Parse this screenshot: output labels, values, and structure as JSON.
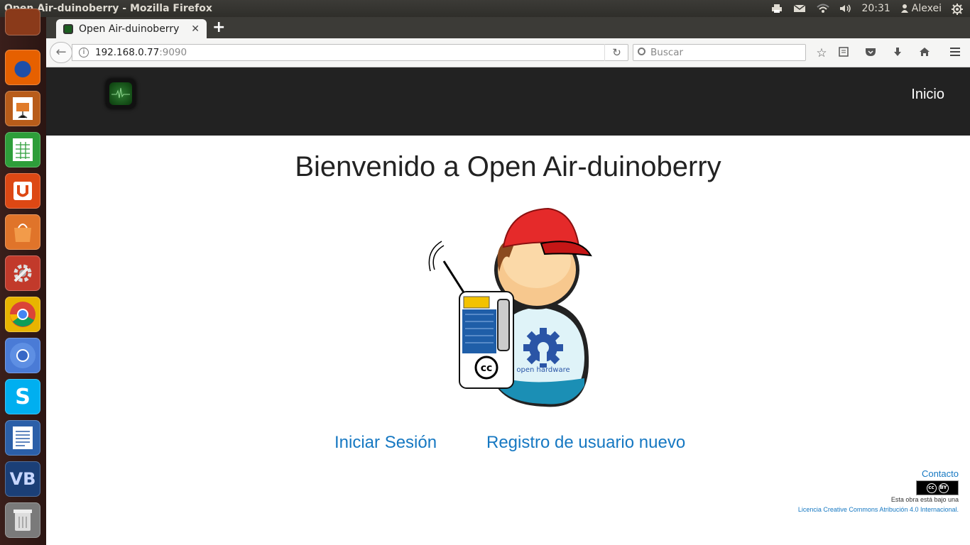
{
  "window": {
    "title": "Open Air-duinoberry - Mozilla Firefox"
  },
  "panel": {
    "time": "20:31",
    "user": "Alexei"
  },
  "launcher": {
    "apps": [
      {
        "name": "firefox",
        "color": "#e66000"
      },
      {
        "name": "impress",
        "color": "#b85c1a"
      },
      {
        "name": "calc",
        "color": "#2e9e3a"
      },
      {
        "name": "ubuntu-one",
        "color": "#dd4814"
      },
      {
        "name": "software-center",
        "color": "#e0742a"
      },
      {
        "name": "system-settings",
        "color": "#c23a2b"
      },
      {
        "name": "chrome",
        "color": "#e8b400"
      },
      {
        "name": "chromium",
        "color": "#4a7bd6"
      },
      {
        "name": "skype",
        "color": "#00aff0"
      },
      {
        "name": "writer",
        "color": "#2b5fa8"
      },
      {
        "name": "virtualbox",
        "color": "#1b3f77"
      },
      {
        "name": "trash",
        "color": "#7a7a7a"
      }
    ]
  },
  "browser": {
    "tab_title": "Open Air-duinoberry",
    "new_tab": "+",
    "url_host": "192.168.0.77",
    "url_port": ":9090",
    "search_placeholder": "Buscar"
  },
  "site": {
    "nav_home": "Inicio",
    "welcome": "Bienvenido a Open Air-duinoberry",
    "mascot_text": "open hardware",
    "cc_label": "cc",
    "login_link": "Iniciar Sesión",
    "register_link": "Registro de usuario nuevo",
    "contact_link": "Contacto",
    "license_badge": "BY",
    "license_text": "Esta obra está bajo una",
    "license_link": "Licencia Creative Commons Atribución 4.0 Internacional."
  }
}
